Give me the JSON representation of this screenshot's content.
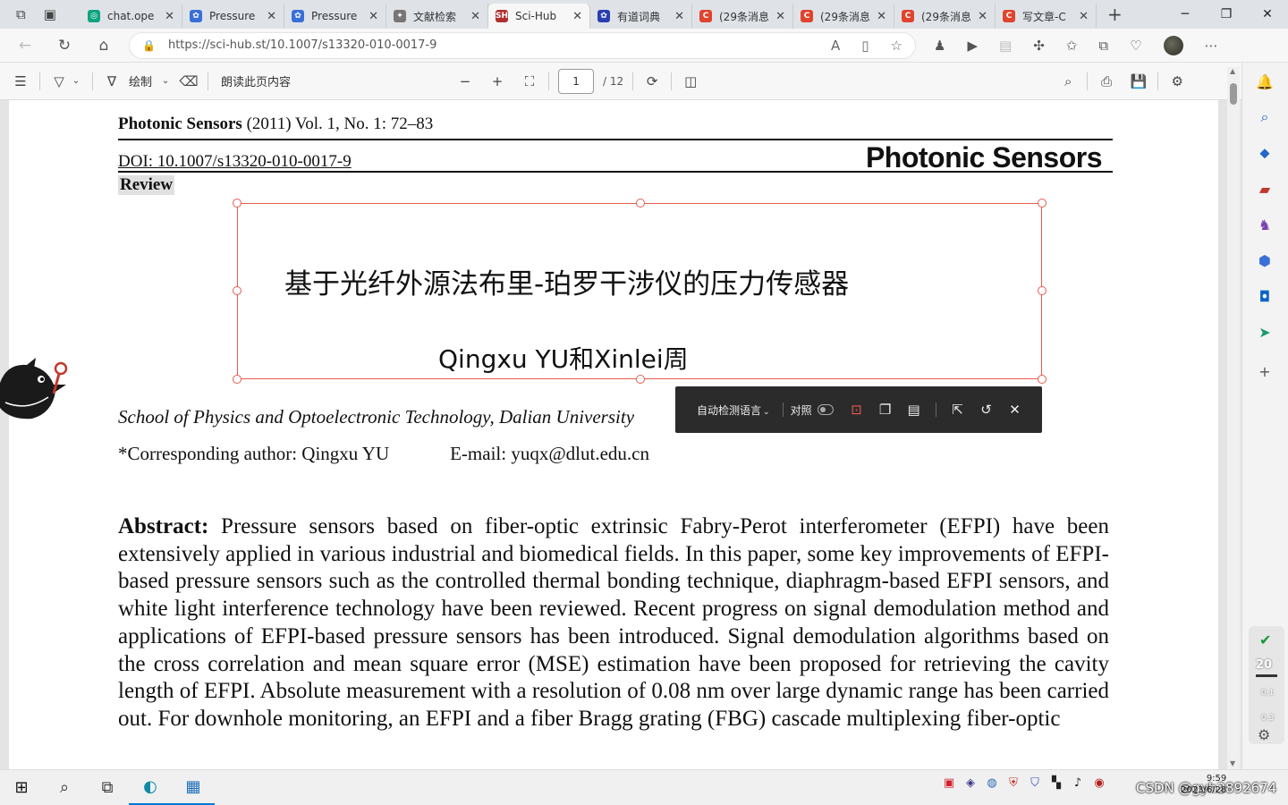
{
  "browser": {
    "tabs": [
      {
        "title": "chat.ope",
        "color": "#10a37f",
        "glyph": "◎"
      },
      {
        "title": "Pressure",
        "color": "#3a6fd8",
        "glyph": "✿"
      },
      {
        "title": "Pressure",
        "color": "#3a6fd8",
        "glyph": "✿"
      },
      {
        "title": "文献检索",
        "color": "#777777",
        "glyph": "✦"
      },
      {
        "title": "Sci-Hub",
        "color": "#b03030",
        "glyph": "SH"
      },
      {
        "title": "有道词典",
        "color": "#2a3fb0",
        "glyph": "✿"
      },
      {
        "title": "(29条消息",
        "color": "#e0442d",
        "glyph": "C"
      },
      {
        "title": "(29条消息",
        "color": "#e0442d",
        "glyph": "C"
      },
      {
        "title": "(29条消息",
        "color": "#e0442d",
        "glyph": "C"
      },
      {
        "title": "写文章-C",
        "color": "#e0442d",
        "glyph": "C"
      }
    ],
    "url": "https://sci-hub.st/10.1007/s13320-010-0017-9"
  },
  "pdf_toolbar": {
    "draw_label": "绘制",
    "read_aloud_label": "朗读此页内容",
    "current_page": "1",
    "total_pages": "/ 12"
  },
  "document": {
    "journal": "Photonic Sensors",
    "citation": " (2011) Vol. 1, No. 1: 72–83",
    "doi": "DOI: 10.1007/s13320-010-0017-9",
    "brand": "Photonic Sensors",
    "section": "Review",
    "affiliation": "School of Physics and Optoelectronic Technology, Dalian University",
    "corresponding": "*Corresponding author: Qingxu YU",
    "email": "E-mail: yuqx@dlut.edu.cn",
    "abstract_label": "Abstract:",
    "abstract_text": " Pressure sensors based on fiber-optic extrinsic Fabry-Perot interferometer (EFPI) have been extensively applied in various industrial and biomedical fields. In this paper, some key improvements of EFPI-based pressure sensors such as the controlled thermal bonding technique, diaphragm-based EFPI sensors, and white light interference technology have been reviewed. Recent progress on signal demodulation method and applications of EFPI-based pressure sensors has been introduced. Signal demodulation algorithms based on the cross correlation and mean square error (MSE) estimation have been proposed for retrieving the cavity length of EFPI. Absolute measurement with a resolution of 0.08 nm over large dynamic range has been carried out. For downhole monitoring, an EFPI and a fiber Bragg grating (FBG) cascade multiplexing fiber-optic"
  },
  "translation_overlay": {
    "title": "基于光纤外源法布里-珀罗干涉仪的压力传感器",
    "authors": "Qingxu YU和Xinlei周",
    "toolbar": {
      "language_label": "自动检测语言",
      "compare_label": "对照"
    }
  },
  "sidebar": {
    "security_number": "20",
    "security_values": [
      "0.1",
      "0.3"
    ]
  },
  "taskbar": {
    "watermark": "CSDN @gyh2892674",
    "time": "9:59",
    "date": "2023/6/28"
  },
  "colors": {
    "accent": "#0078d4",
    "overlay_border": "#e85a4f",
    "overlay_toolbar": "#2b2b2b"
  }
}
